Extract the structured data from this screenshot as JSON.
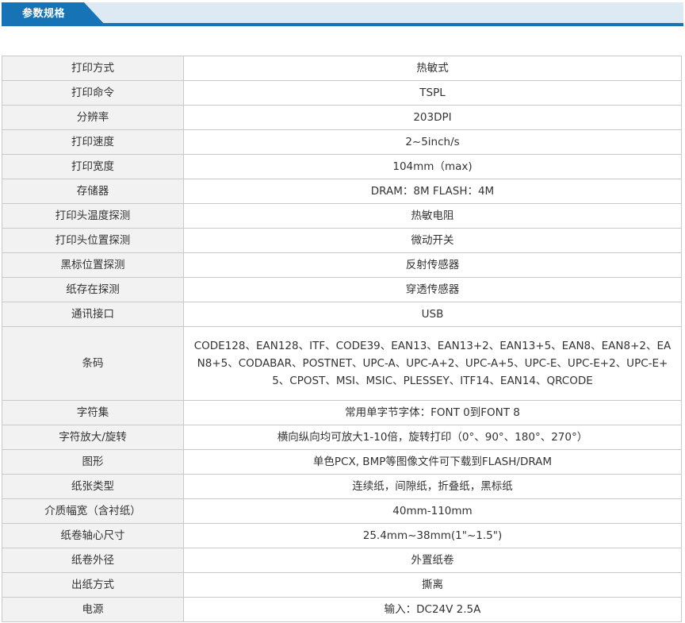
{
  "header": {
    "title": "参数规格"
  },
  "specs": [
    {
      "label": "打印方式",
      "value": "热敏式"
    },
    {
      "label": "打印命令",
      "value": "TSPL"
    },
    {
      "label": "分辨率",
      "value": "203DPI"
    },
    {
      "label": "打印速度",
      "value": "2~5inch/s"
    },
    {
      "label": "打印宽度",
      "value": "104mm（max)"
    },
    {
      "label": "存储器",
      "value": "DRAM：8M FLASH：4M"
    },
    {
      "label": "打印头温度探测",
      "value": "热敏电阻"
    },
    {
      "label": "打印头位置探测",
      "value": "微动开关"
    },
    {
      "label": "黑标位置探测",
      "value": "反射传感器"
    },
    {
      "label": "纸存在探测",
      "value": "穿透传感器"
    },
    {
      "label": "通讯接口",
      "value": "USB"
    },
    {
      "label": "条码",
      "value": "CODE128、EAN128、ITF、CODE39、EAN13、EAN13+2、EAN13+5、EAN8、EAN8+2、EAN8+5、CODABAR、POSTNET、UPC-A、UPC-A+2、UPC-A+5、UPC-E、UPC-E+2、UPC-E+5、CPOST、MSI、MSIC、PLESSEY、ITF14、EAN14、QRCODE"
    },
    {
      "label": "字符集",
      "value": "常用单字节字体：FONT 0到FONT 8"
    },
    {
      "label": "字符放大/旋转",
      "value": "横向纵向均可放大1-10倍，旋转打印（0°、90°、180°、270°）"
    },
    {
      "label": "图形",
      "value": "单色PCX, BMP等图像文件可下载到FLASH/DRAM"
    },
    {
      "label": "纸张类型",
      "value": "连续纸，间隙纸，折叠纸，黑标纸"
    },
    {
      "label": "介质幅宽（含衬纸）",
      "value": "40mm-110mm"
    },
    {
      "label": "纸卷轴心尺寸",
      "value": "25.4mm~38mm(1\"~1.5\")"
    },
    {
      "label": "纸卷外径",
      "value": "外置纸卷"
    },
    {
      "label": "出纸方式",
      "value": "撕离"
    },
    {
      "label": "电源",
      "value": "输入：DC24V 2.5A"
    }
  ]
}
